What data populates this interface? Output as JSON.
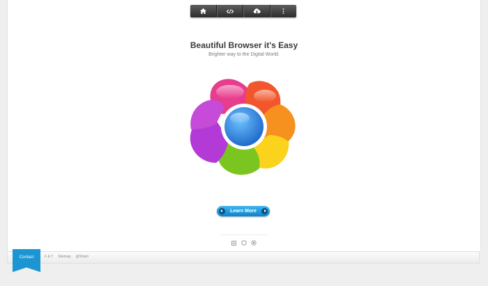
{
  "nav": {
    "items": [
      {
        "name": "home-icon"
      },
      {
        "name": "code-icon"
      },
      {
        "name": "cloud-download-icon"
      },
      {
        "name": "more-vertical-icon"
      }
    ]
  },
  "hero": {
    "title": "Beautiful Browser it's Easy",
    "subtitle": "Brighter way to the Digital World."
  },
  "cta": {
    "label": "Learn More"
  },
  "bottom_icons": [
    "grid-icon",
    "circle-icon",
    "globe-icon"
  ],
  "footer": {
    "ribbon_label": "Contact",
    "links": [
      "F & T",
      "Sitemap",
      "@Shiyin"
    ]
  },
  "colors": {
    "accent": "#1c95d2",
    "petals": [
      "#e83c8c",
      "#f2562c",
      "#f6901e",
      "#fbd21c",
      "#7bc520",
      "#b33ad6"
    ],
    "center": "#2b82de"
  }
}
